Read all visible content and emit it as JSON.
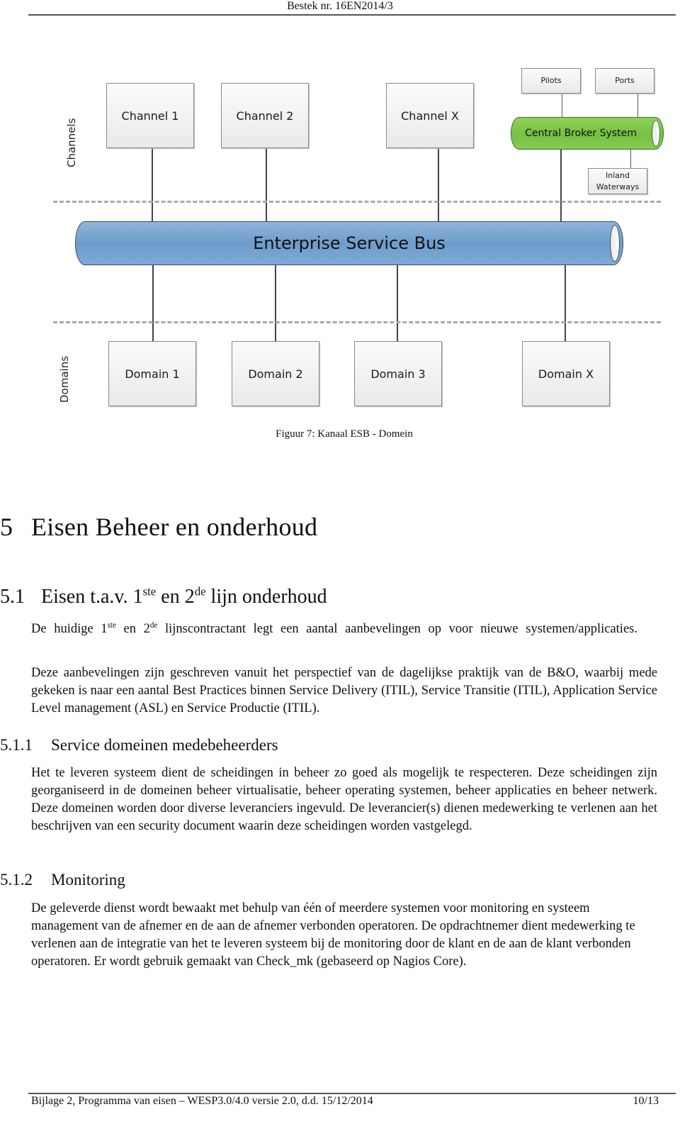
{
  "header": {
    "text": "Bestek nr. 16EN2014/3"
  },
  "figure": {
    "side_labels": {
      "channels": "Channels",
      "domains": "Domains"
    },
    "channels": [
      "Channel 1",
      "Channel 2",
      "Channel X"
    ],
    "broker": {
      "label": "Central Broker System",
      "top_nodes": [
        "Pilots",
        "Ports"
      ],
      "bottom_node": [
        "Inland",
        "Waterways"
      ],
      "color": "#7ac143"
    },
    "bus": {
      "label": "Enterprise Service Bus",
      "color": "#6f9ccb"
    },
    "domains": [
      "Domain 1",
      "Domain 2",
      "Domain 3",
      "Domain X"
    ],
    "caption": "Figuur 7: Kanaal ESB - Domein"
  },
  "section": {
    "number": "5",
    "title": "Eisen Beheer en onderhoud"
  },
  "subsection": {
    "number": "5.1",
    "title_parts": {
      "a": "Eisen t.a.v. 1",
      "sup1": "ste",
      "b": " en 2",
      "sup2": "de",
      "c": " lijn onderhoud"
    },
    "intro_parts": {
      "a": "De huidige 1",
      "sup1": "ste",
      "b": " en 2",
      "sup2": "de",
      "c": " lijnscontractant legt een aantal aanbevelingen op voor nieuwe systemen/applicaties."
    },
    "paragraph": "Deze aanbevelingen zijn geschreven vanuit het perspectief van de dagelijkse praktijk van de B&O, waarbij mede gekeken is naar een aantal Best Practices binnen Service Delivery (ITIL), Service Transitie (ITIL), Application Service Level management (ASL) en Service Productie (ITIL)."
  },
  "subsubsections": [
    {
      "number": "5.1.1",
      "title": "Service domeinen medebeheerders",
      "text": "Het te leveren systeem dient de scheidingen in beheer zo goed als mogelijk te respecteren. Deze scheidingen zijn georganiseerd in de domeinen beheer virtualisatie, beheer operating systemen, beheer applicaties en beheer netwerk. Deze domeinen worden door diverse leveranciers ingevuld. De leverancier(s) dienen medewerking te verlenen aan het beschrijven van een security document waarin deze scheidingen worden vastgelegd."
    },
    {
      "number": "5.1.2",
      "title": "Monitoring",
      "text": "De geleverde dienst wordt bewaakt met behulp van één of meerdere systemen voor monitoring en systeem management van de afnemer en de aan de afnemer verbonden operatoren. De opdrachtnemer dient medewerking te verlenen aan de integratie van het te leveren systeem bij de monitoring door de klant en de aan de klant verbonden operatoren. Er wordt gebruik gemaakt van Check_mk (gebaseerd op Nagios Core)."
    }
  ],
  "footer": {
    "text": "Bijlage 2, Programma van eisen – WESP3.0/4.0 versie 2.0, d.d. 15/12/2014",
    "page": "10/13"
  }
}
